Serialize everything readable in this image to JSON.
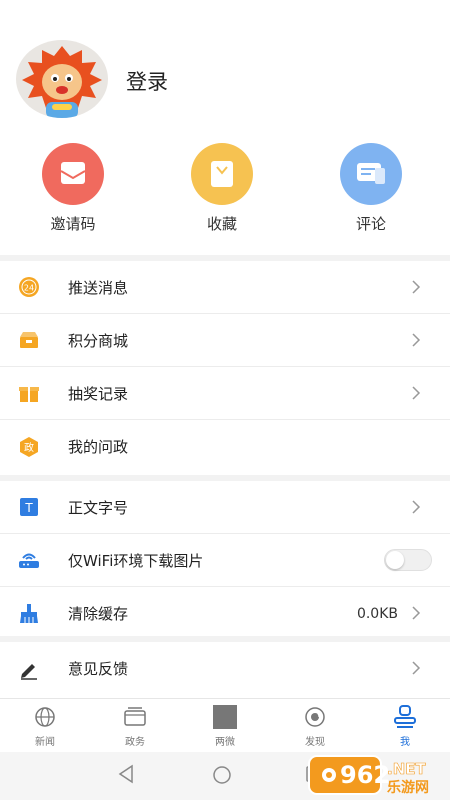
{
  "profile": {
    "login_label": "登录"
  },
  "quick_actions": [
    {
      "label": "邀请码",
      "icon": "envelope-icon",
      "color": "#f06a5e"
    },
    {
      "label": "收藏",
      "icon": "bookmark-icon",
      "color": "#f6c251"
    },
    {
      "label": "评论",
      "icon": "comment-icon",
      "color": "#7fb3f1"
    }
  ],
  "menu_groups": [
    [
      {
        "label": "推送消息",
        "icon": "push-24-icon"
      },
      {
        "label": "积分商城",
        "icon": "points-mall-icon"
      },
      {
        "label": "抽奖记录",
        "icon": "gift-icon"
      },
      {
        "label": "我的问政",
        "icon": "politics-badge-icon",
        "badge_text": "政"
      }
    ],
    [
      {
        "label": "正文字号",
        "icon": "font-size-icon",
        "badge_text": "T"
      },
      {
        "label": "仅WiFi环境下载图片",
        "icon": "router-icon",
        "toggle": false
      },
      {
        "label": "清除缓存",
        "icon": "broom-icon",
        "value": "0.0KB"
      }
    ],
    [
      {
        "label": "意见反馈",
        "icon": "pen-icon"
      }
    ]
  ],
  "tabs": [
    {
      "label": "新闻",
      "icon": "globe-icon"
    },
    {
      "label": "政务",
      "icon": "folder-icon"
    },
    {
      "label": "两微",
      "icon": "square-icon"
    },
    {
      "label": "发现",
      "icon": "discover-icon"
    },
    {
      "label": "我",
      "icon": "user-icon",
      "active": true
    }
  ],
  "watermark": {
    "text": "962",
    "suffix": ".NET",
    "sub": "乐游网"
  },
  "colors": {
    "accent": "#1e6fd9",
    "icon_orange": "#f5a623"
  }
}
